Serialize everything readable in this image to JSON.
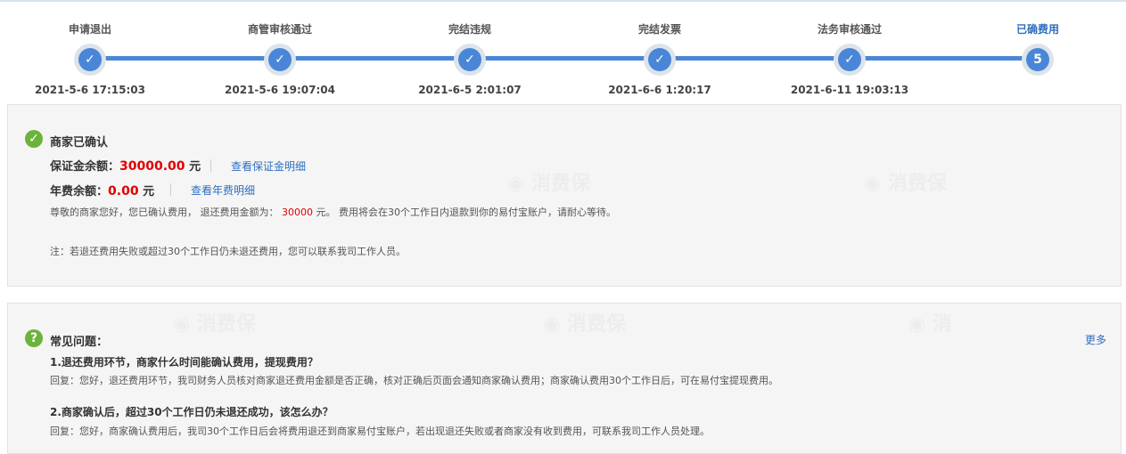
{
  "progress": {
    "steps": [
      {
        "label": "申请退出",
        "time": "2021-5-6 17:15:03",
        "icon": "check-icon"
      },
      {
        "label": "商管审核通过",
        "time": "2021-5-6 19:07:04",
        "icon": "check-icon"
      },
      {
        "label": "完结违规",
        "time": "2021-6-5 2:01:07",
        "icon": "check-icon"
      },
      {
        "label": "完结发票",
        "time": "2021-6-6 1:20:17",
        "icon": "check-icon"
      },
      {
        "label": "法务审核通过",
        "time": "2021-6-11 19:03:13",
        "icon": "check-icon"
      },
      {
        "label": "已确费用",
        "number": "5"
      }
    ]
  },
  "status": {
    "title": "商家已确认",
    "deposit_label": "保证金余额：",
    "deposit_value": "30000.00",
    "deposit_unit": "元",
    "deposit_link": "查看保证金明细",
    "annual_label": "年费余额：",
    "annual_value": "0.00",
    "annual_unit": "元",
    "annual_link": "查看年费明细",
    "message_prefix": "尊敬的商家您好，您已确认费用， 退还费用金额为：",
    "message_amount": "30000",
    "message_suffix": " 元。 费用将会在30个工作日内退款到你的易付宝账户，请耐心等待。",
    "note": "注：若退还费用失败或超过30个工作日仍未退还费用，您可以联系我司工作人员。"
  },
  "faq": {
    "title": "常见问题：",
    "more": "更多",
    "items": [
      {
        "q": "1.退还费用环节，商家什么时间能确认费用，提现费用？",
        "a": "回复：您好，退还费用环节，我司财务人员核对商家退还费用金额是否正确，核对正确后页面会通知商家确认费用；商家确认费用30个工作日后，可在易付宝提现费用。"
      },
      {
        "q": "2.商家确认后，超过30个工作日仍未退还成功，该怎么办？",
        "a": "回复：您好，商家确认费用后，我司30个工作日后会将费用退还到商家易付宝账户，若出现退还失败或者商家没有收到费用，可联系我司工作人员处理。"
      }
    ]
  },
  "colors": {
    "accent": "#4a86d8",
    "success": "#6bb33a",
    "amount": "#e00000",
    "link": "#2f6fbe"
  }
}
